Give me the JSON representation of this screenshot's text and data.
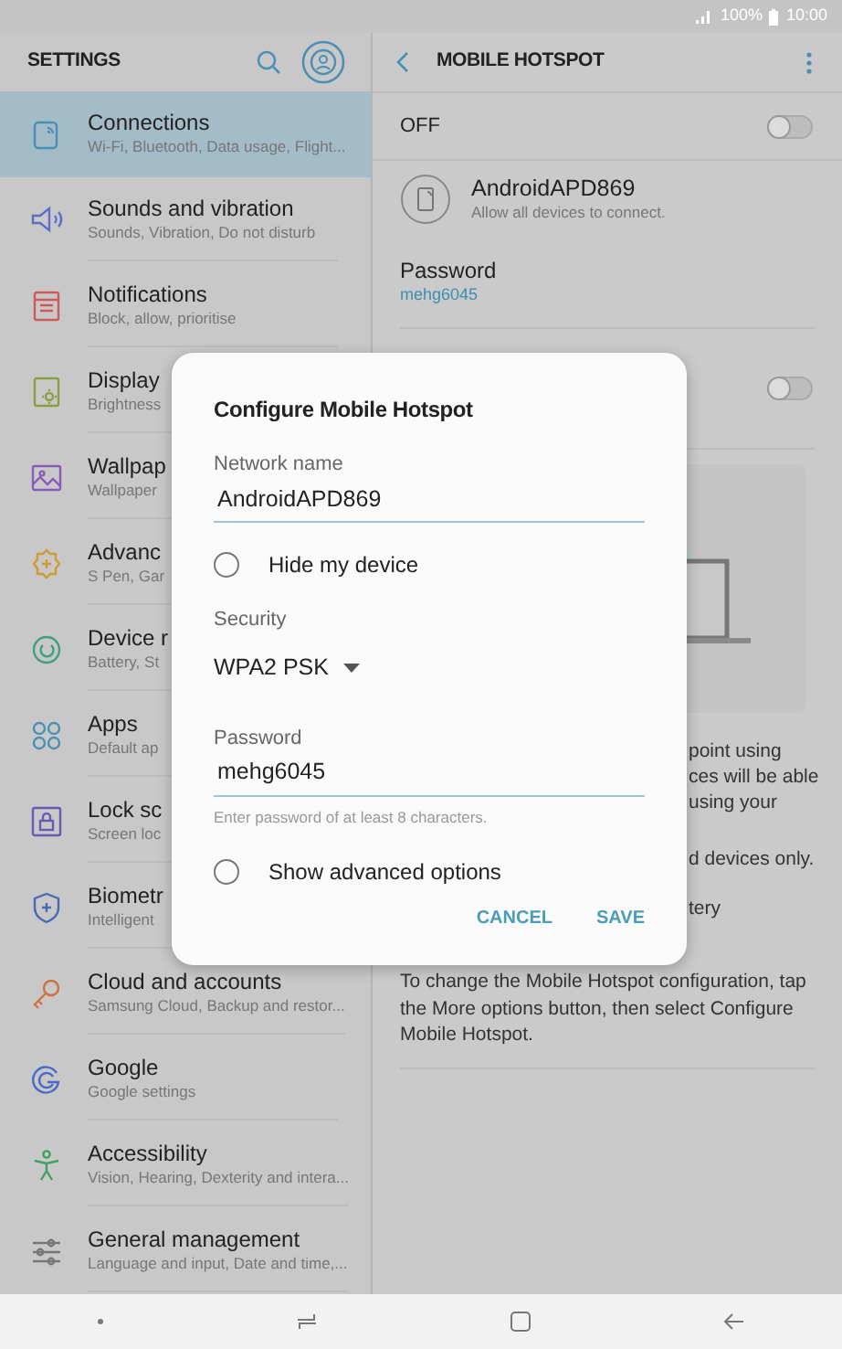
{
  "status_bar": {
    "battery": "100%",
    "time": "10:00"
  },
  "settings": {
    "title": "SETTINGS",
    "items": [
      {
        "title": "Connections",
        "subtitle": "Wi-Fi, Bluetooth, Data usage, Flight...",
        "selected": true
      },
      {
        "title": "Sounds and vibration",
        "subtitle": "Sounds, Vibration, Do not disturb",
        "selected": false
      },
      {
        "title": "Notifications",
        "subtitle": "Block, allow, prioritise",
        "selected": false
      },
      {
        "title": "Display",
        "subtitle": "Brightness",
        "selected": false
      },
      {
        "title": "Wallpap",
        "subtitle": "Wallpaper",
        "selected": false
      },
      {
        "title": "Advanc",
        "subtitle": "S Pen, Gar",
        "selected": false
      },
      {
        "title": "Device r",
        "subtitle": "Battery, St",
        "selected": false
      },
      {
        "title": "Apps",
        "subtitle": "Default ap",
        "selected": false
      },
      {
        "title": "Lock sc",
        "subtitle": "Screen loc",
        "selected": false
      },
      {
        "title": "Biometr",
        "subtitle": "Intelligent",
        "selected": false
      },
      {
        "title": "Cloud and accounts",
        "subtitle": "Samsung Cloud, Backup and restor...",
        "selected": false
      },
      {
        "title": "Google",
        "subtitle": "Google settings",
        "selected": false
      },
      {
        "title": "Accessibility",
        "subtitle": "Vision, Hearing, Dexterity and intera...",
        "selected": false
      },
      {
        "title": "General management",
        "subtitle": "Language and input, Date and time,...",
        "selected": false
      }
    ]
  },
  "hotspot": {
    "title": "MOBILE HOTSPOT",
    "master": {
      "label": "OFF",
      "on": false
    },
    "network": {
      "name": "AndroidAPD869",
      "subtitle": "Allow all devices to connect."
    },
    "password": {
      "label": "Password",
      "value": "mehg6045"
    },
    "second_toggle": {
      "on": false
    },
    "description_fragments": [
      "point using",
      "ces will be able",
      "using your",
      "d devices only.",
      "tery"
    ],
    "footer_note": "To change the Mobile Hotspot configuration, tap the More options button, then select Configure Mobile Hotspot."
  },
  "dialog": {
    "title": "Configure Mobile Hotspot",
    "network_name": {
      "label": "Network name",
      "value": "AndroidAPD869"
    },
    "hide_device": {
      "label": "Hide my device",
      "checked": false
    },
    "security": {
      "label": "Security",
      "value": "WPA2 PSK"
    },
    "password": {
      "label": "Password",
      "value": "mehg6045",
      "hint": "Enter password of at least 8 characters."
    },
    "advanced": {
      "label": "Show advanced options",
      "checked": false
    },
    "buttons": [
      "CANCEL",
      "SAVE"
    ]
  }
}
